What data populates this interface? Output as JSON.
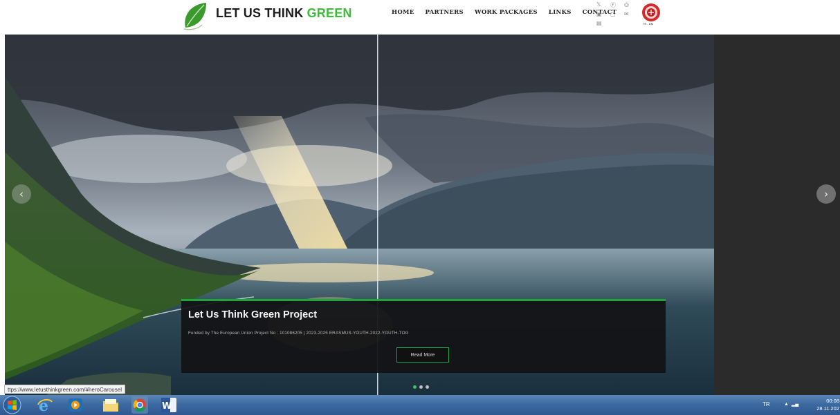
{
  "site": {
    "brand_part1": "LET US THINK ",
    "brand_part2": "GREEN",
    "brand_color": "#3ebd3a",
    "accent_color": "#20a53a"
  },
  "nav": [
    "HOME",
    "PARTNERS",
    "WORK PACKAGES",
    "LINKS",
    "CONTACT"
  ],
  "social_icons": [
    "twitter-icon",
    "facebook-icon",
    "instagram-icon",
    "linkedin-icon",
    "google-icon",
    "email-icon",
    "youtube-icon"
  ],
  "emblem": {
    "icon": "tr-emblem-icon",
    "text": "TR - DM"
  },
  "hero": {
    "caption_title": "Let Us Think Green Project",
    "caption_text": "Funded by The European Union Project No : 101086205 | 2023-2025 ERASMUS-YOUTH-2022-YOUTH-TOG",
    "button_label": "Read More",
    "slides": 3,
    "active_slide": 1,
    "prev_icon": "chevron-left-icon",
    "next_icon": "chevron-right-icon"
  },
  "browser": {
    "status_url": "ttps://www.letusthinkgreen.com/#heroCarousel"
  },
  "taskbar": {
    "apps": [
      "windows-start-icon",
      "internet-explorer-icon",
      "media-player-icon",
      "file-explorer-icon",
      "chrome-icon",
      "word-icon"
    ],
    "language": "TR",
    "time": "00:08",
    "date": "28.11.202"
  }
}
